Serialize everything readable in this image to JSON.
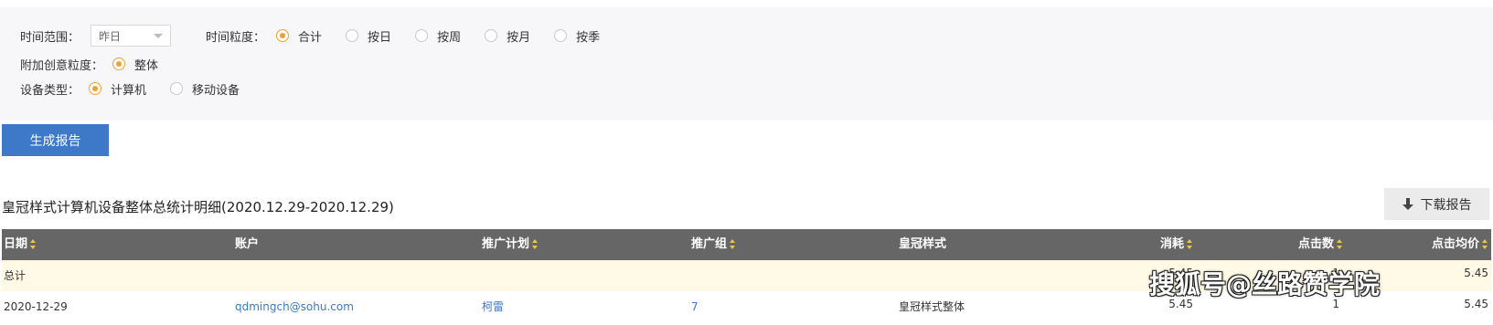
{
  "filters": {
    "time_range": {
      "label": "时间范围：",
      "value": "昨日"
    },
    "granularity": {
      "label": "时间粒度：",
      "options": [
        "合计",
        "按日",
        "按周",
        "按月",
        "按季"
      ],
      "selected": "合计"
    },
    "creative": {
      "label": "附加创意粒度：",
      "options": [
        "整体"
      ],
      "selected": "整体"
    },
    "device": {
      "label": "设备类型：",
      "options": [
        "计算机",
        "移动设备"
      ],
      "selected": "计算机"
    }
  },
  "generate_button": "生成报告",
  "report": {
    "title": "皇冠样式计算机设备整体总统计明细(2020.12.29-2020.12.29)",
    "download_button": "下载报告"
  },
  "table": {
    "columns": [
      "日期",
      "账户",
      "推广计划",
      "推广组",
      "皇冠样式",
      "消耗",
      "点击数",
      "点击均价"
    ],
    "total_row": {
      "label": "总计",
      "cost": "5.45",
      "clicks": "1",
      "avg_price": "5.45"
    },
    "rows": [
      {
        "date": "2020-12-29",
        "account": "qdmingch@sohu.com",
        "plan": "柯雷",
        "group": "7",
        "style": "皇冠样式整体",
        "cost": "5.45",
        "clicks": "1",
        "avg_price": "5.45"
      }
    ]
  },
  "watermark": "搜狐号@丝路赞学院",
  "colors": {
    "accent_blue": "#3d79c8",
    "radio_orange": "#f0a132",
    "header_gray": "#666666",
    "total_row_bg": "#fff9e5"
  }
}
